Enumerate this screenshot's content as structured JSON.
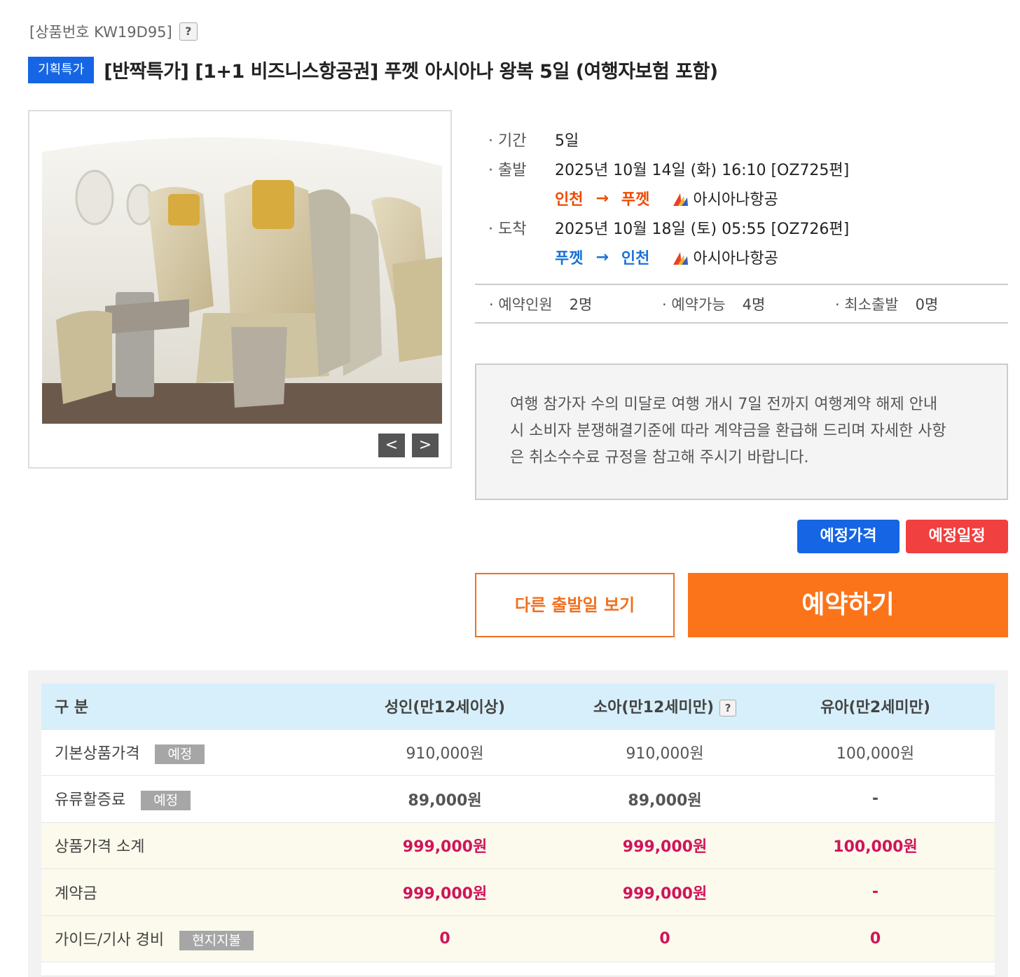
{
  "product": {
    "code_text": "[상품번호 KW19D95]",
    "help_glyph": "?",
    "promo_badge": "기획특가",
    "title": "[반짝특가] [1+1 비즈니스항공권] 푸껫 아시아나 왕복 5일 (여행자보험 포함)"
  },
  "gallery": {
    "prev_label": "<",
    "next_label": ">"
  },
  "info": {
    "duration_label": "· 기간",
    "duration_value": "5일",
    "departure_label": "· 출발",
    "departure_value": "2025년 10월 14일 (화) 16:10 [OZ725편]",
    "departure_from": "인천",
    "departure_to": "푸껫",
    "arrow": "→",
    "departure_airline": "아시아나항공",
    "arrival_label": "· 도착",
    "arrival_value": "2025년 10월 18일 (토) 05:55 [OZ726편]",
    "arrival_from": "푸껫",
    "arrival_to": "인천",
    "arrival_airline": "아시아나항공"
  },
  "pax": {
    "booked_label": "· 예약인원",
    "booked_value": "2명",
    "available_label": "· 예약가능",
    "available_value": "4명",
    "min_label": "· 최소출발",
    "min_value": "0명"
  },
  "notice": {
    "line1": "여행 참가자 수의 미달로 여행 개시 7일 전까지 여행계약 해제 안내",
    "line2": "시 소비자 분쟁해결기준에 따라 계약금을 환급해 드리며 자세한 사항",
    "line3": "은 취소수수료 규정을 참고해 주시기 바랍니다."
  },
  "buttons": {
    "price": "예정가격",
    "schedule": "예정일정",
    "other_dates": "다른 출발일 보기",
    "book": "예약하기"
  },
  "colors": {
    "brand_blue": "#1565e5",
    "brand_red": "#f04040",
    "book_orange": "#fb741a",
    "price_red": "#d0145a"
  },
  "price_table": {
    "headers": {
      "category": "구 분",
      "adult": "성인(만12세이상)",
      "child": "소아(만12세미만)",
      "infant": "유아(만2세미만)"
    },
    "rows": [
      {
        "label": "기본상품가격",
        "tag": "예정",
        "adult": "910,000원",
        "child": "910,000원",
        "infant": "100,000원"
      },
      {
        "label": "유류할증료",
        "tag": "예정",
        "adult": "89,000원",
        "child": "89,000원",
        "infant": "-"
      },
      {
        "label": "상품가격 소계",
        "adult": "999,000원",
        "child": "999,000원",
        "infant": "100,000원"
      },
      {
        "label": "계약금",
        "adult": "999,000원",
        "child": "999,000원",
        "infant": "-"
      },
      {
        "label": "가이드/기사 경비",
        "tag": "현지지불",
        "adult": "0",
        "child": "0",
        "infant": "0"
      }
    ]
  }
}
